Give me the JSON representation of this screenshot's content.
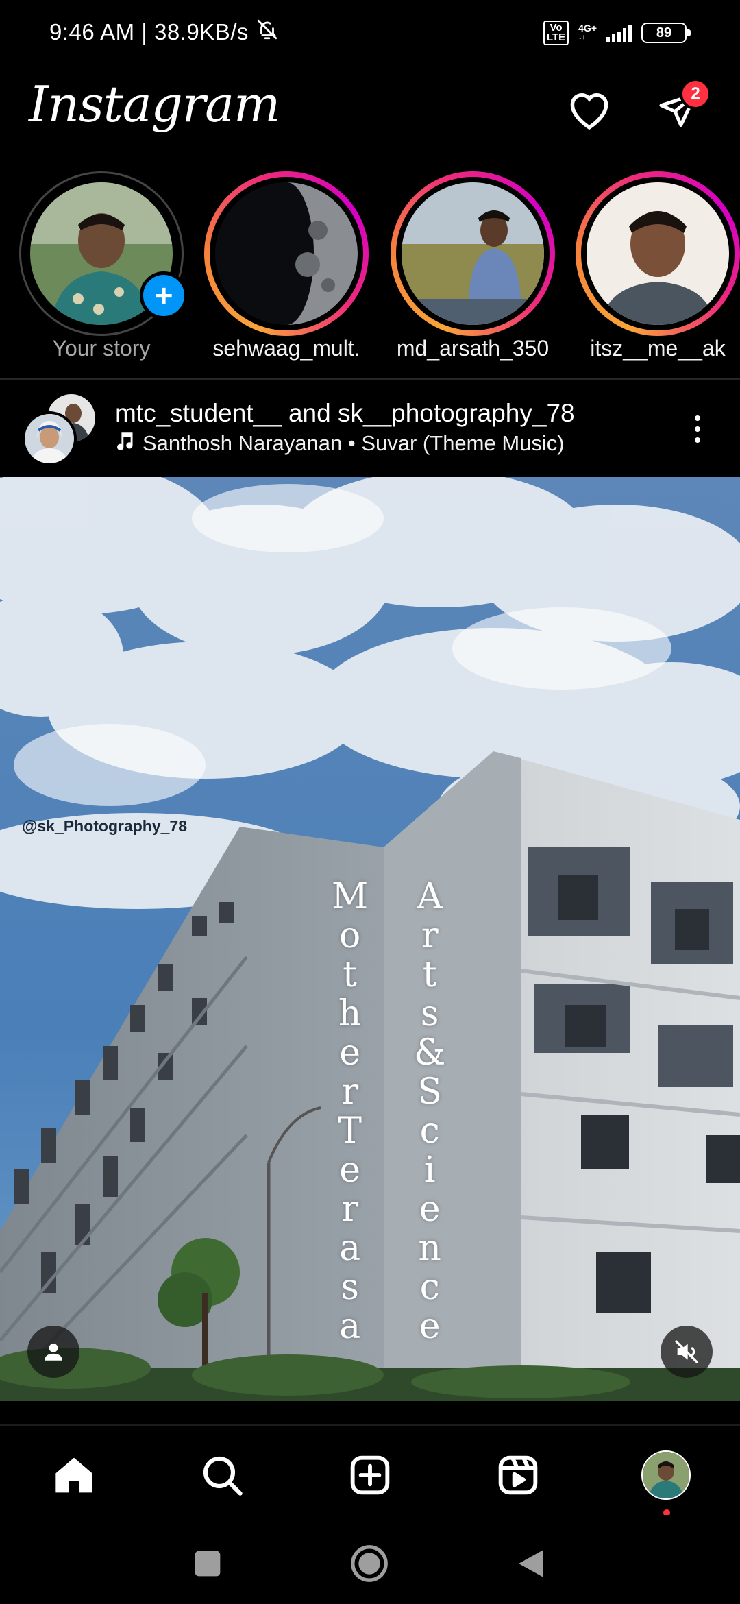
{
  "status_bar": {
    "time_speed": "9:46 AM | 38.9KB/s",
    "volte_label": "Vo\nLTE",
    "network_label": "4G+",
    "battery": "89"
  },
  "header": {
    "logo": "Instagram",
    "dm_badge_count": "2"
  },
  "stories": [
    {
      "label": "Your story",
      "own": true
    },
    {
      "label": "sehwaag_mult."
    },
    {
      "label": "md_arsath_350"
    },
    {
      "label": "itsz__me__ak"
    }
  ],
  "post": {
    "authors": "mtc_student__ and sk__photography_78",
    "audio": "Santhosh Narayanan • Suvar (Theme Music)",
    "watermark": "@sk_Photography_78",
    "building_text_left": "MotherTerasa",
    "building_text_right": "Arts&Science"
  },
  "colors": {
    "accent_blue": "#0095f6",
    "badge_red": "#ff3040",
    "background": "#000000"
  },
  "bottom_nav": [
    "home-icon",
    "search-icon",
    "create-icon",
    "reels-icon",
    "profile-avatar"
  ],
  "system_nav": [
    "recents-square",
    "home-circle",
    "back-triangle"
  ]
}
